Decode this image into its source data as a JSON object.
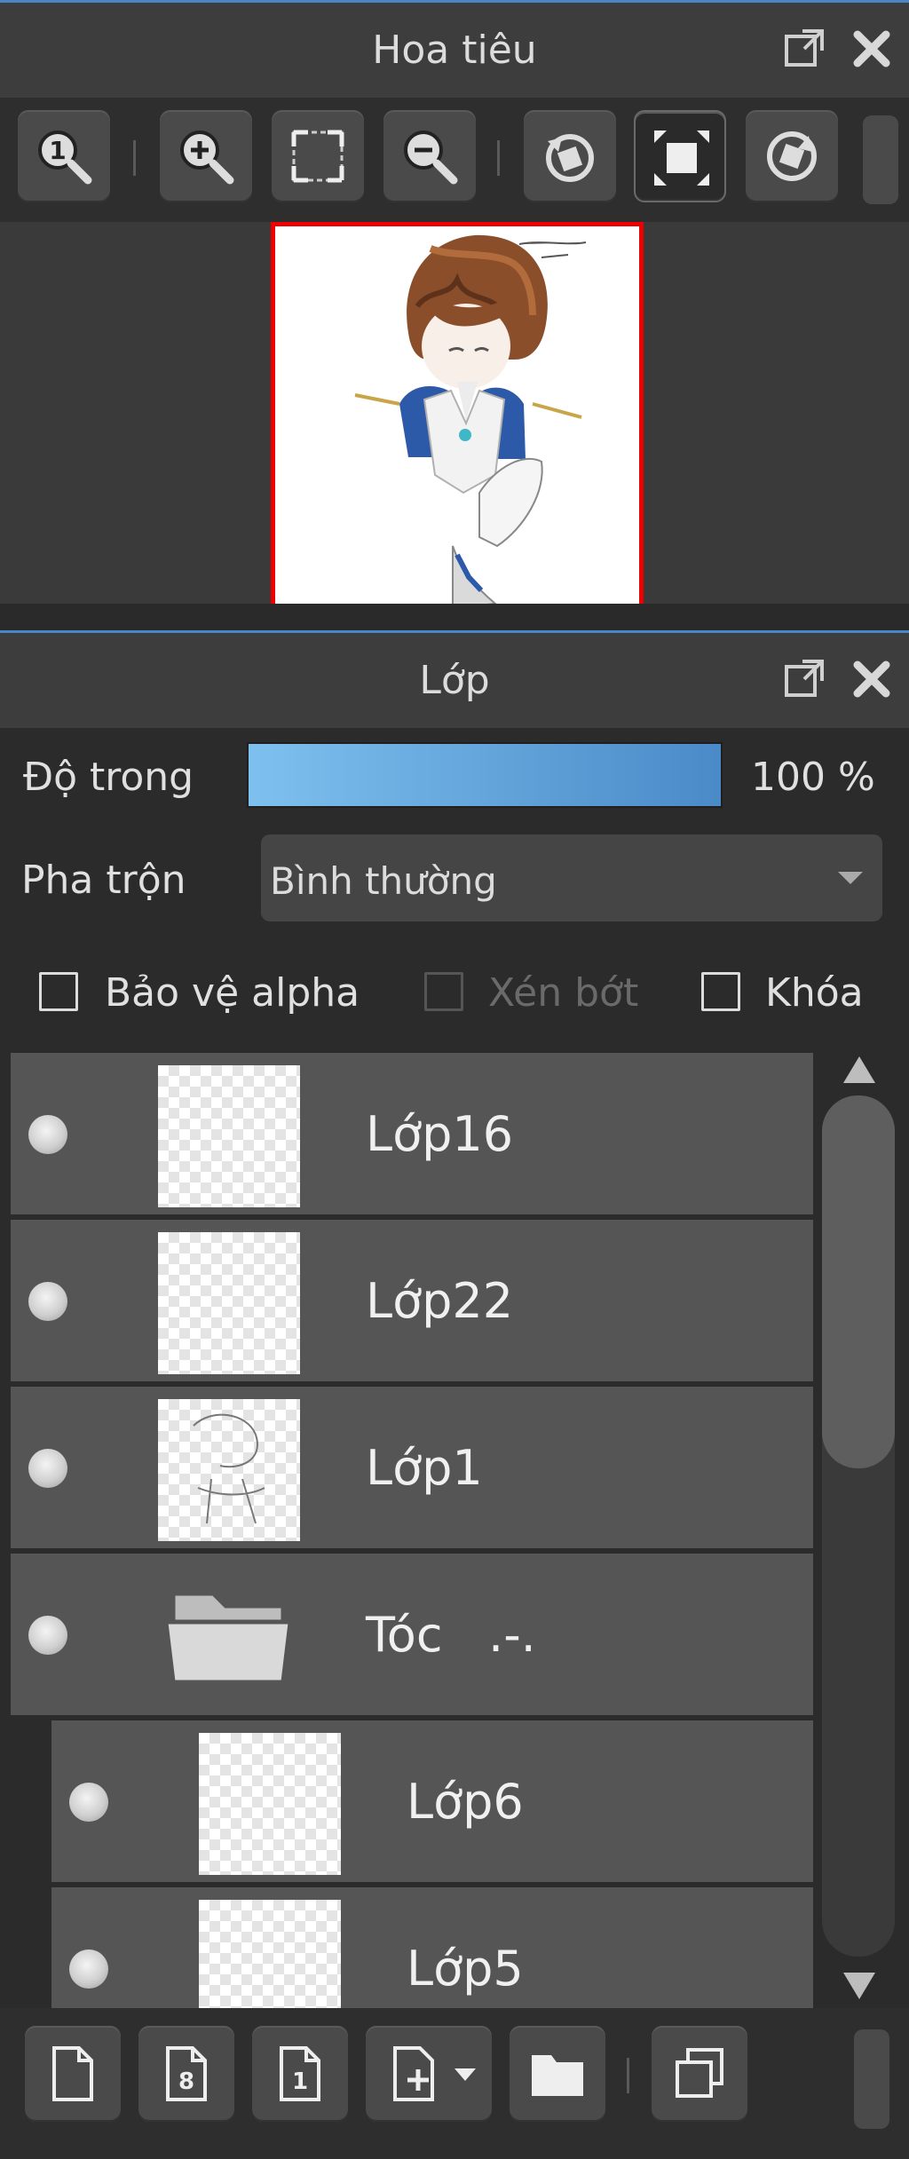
{
  "navigator": {
    "title": "Hoa tiêu",
    "toolbar": [
      "zoom-actual-icon",
      "zoom-in-icon",
      "fit-screen-icon",
      "zoom-out-icon",
      "rotate-left-icon",
      "fullscreen-icon",
      "rotate-reset-icon"
    ],
    "active_tool": "fullscreen-icon"
  },
  "layers": {
    "title": "Lớp",
    "opacity_label": "Độ trong",
    "opacity_value": "100 %",
    "opacity_fraction": 1.0,
    "blend_label": "Pha trộn",
    "blend_value": "Bình thường",
    "checkboxes": [
      {
        "label": "Bảo vệ alpha",
        "checked": false,
        "enabled": true
      },
      {
        "label": "Xén bớt",
        "checked": false,
        "enabled": false
      },
      {
        "label": "Khóa",
        "checked": false,
        "enabled": true
      }
    ],
    "items": [
      {
        "name": "Lớp16",
        "type": "layer",
        "visible": true
      },
      {
        "name": "Lớp22",
        "type": "layer",
        "visible": true
      },
      {
        "name": "Lớp1",
        "type": "layer",
        "visible": true
      },
      {
        "name": "Tóc   .-.",
        "type": "folder",
        "visible": true
      },
      {
        "name": "Lớp6",
        "type": "layer",
        "visible": true,
        "child": true
      },
      {
        "name": "Lớp5",
        "type": "layer",
        "visible": true,
        "child": true
      }
    ]
  },
  "bottom_toolbar": [
    "new-layer-icon",
    "new-8bit-layer-icon",
    "new-1bit-layer-icon",
    "add-layer-menu-icon",
    "new-folder-icon",
    "duplicate-layer-icon"
  ],
  "colors": {
    "accent": "#4a86c5",
    "opacity_bar_start": "#7ec0ee",
    "opacity_bar_end": "#4a8ac8",
    "canvas_border": "#e00000"
  }
}
